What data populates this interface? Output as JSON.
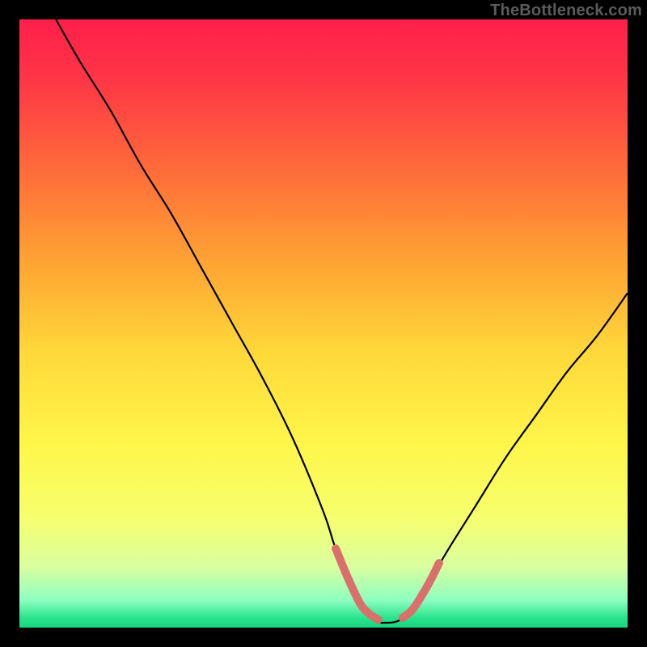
{
  "watermark": "TheBottleneck.com",
  "chart_data": {
    "type": "line",
    "title": "",
    "xlabel": "",
    "ylabel": "",
    "xlim": [
      0,
      100
    ],
    "ylim": [
      0,
      100
    ],
    "grid": false,
    "legend": false,
    "gradient_stops": [
      {
        "offset": 0.0,
        "color": "#ff1f4b"
      },
      {
        "offset": 0.1,
        "color": "#ff3647"
      },
      {
        "offset": 0.25,
        "color": "#ff6c3a"
      },
      {
        "offset": 0.4,
        "color": "#ffa433"
      },
      {
        "offset": 0.55,
        "color": "#ffd93a"
      },
      {
        "offset": 0.7,
        "color": "#fff64a"
      },
      {
        "offset": 0.82,
        "color": "#f6ff6e"
      },
      {
        "offset": 0.9,
        "color": "#d9ffa0"
      },
      {
        "offset": 0.955,
        "color": "#8effc0"
      },
      {
        "offset": 0.985,
        "color": "#27e28a"
      },
      {
        "offset": 1.0,
        "color": "#17d67e"
      }
    ],
    "series": [
      {
        "name": "bottleneck-curve",
        "stroke": "#000000",
        "stroke_width": 2.2,
        "x": [
          6,
          10,
          15,
          20,
          25,
          30,
          35,
          40,
          45,
          50,
          52,
          55,
          57,
          59,
          60,
          62,
          64,
          66,
          70,
          75,
          80,
          85,
          90,
          95,
          100
        ],
        "y": [
          100,
          93,
          85,
          76,
          68,
          59,
          50,
          41,
          31,
          19,
          13,
          6,
          2.5,
          1.0,
          0.8,
          1.0,
          2.2,
          5,
          12,
          20,
          28,
          35,
          42,
          48,
          55
        ]
      },
      {
        "name": "optimal-marker-left",
        "stroke": "#d9706c",
        "stroke_width": 10,
        "linecap": "round",
        "x": [
          52,
          54,
          56,
          57.5,
          59
        ],
        "y": [
          13,
          8.2,
          4.0,
          2.3,
          1.3
        ]
      },
      {
        "name": "optimal-marker-right",
        "stroke": "#d9706c",
        "stroke_width": 10,
        "linecap": "round",
        "x": [
          63,
          64.5,
          66,
          67.5,
          69
        ],
        "y": [
          1.6,
          2.8,
          5.0,
          7.6,
          10.6
        ]
      }
    ]
  }
}
